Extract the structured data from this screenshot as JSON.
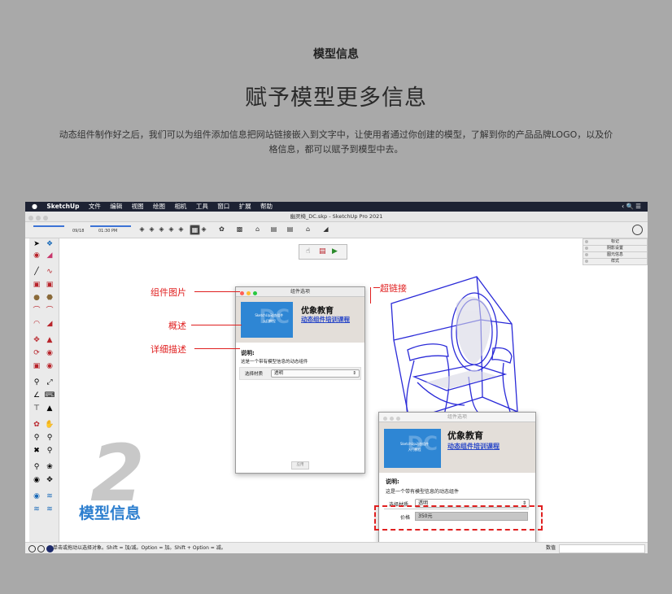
{
  "header": {
    "section": "模型信息",
    "title": "赋予模型更多信息",
    "desc": "动态组件制作好之后，我们可以为组件添加信息把网站链接嵌入到文字中，让使用者通过你创建的模型，了解到你的产品品牌LOGO，以及价格信息，都可以赋予到模型中去。"
  },
  "menubar": {
    "apple": "",
    "items": [
      "SketchUp",
      "文件",
      "编辑",
      "视图",
      "绘图",
      "相机",
      "工具",
      "窗口",
      "扩展",
      "帮助"
    ],
    "right": "‹  🔍  ☰"
  },
  "window": {
    "title": "幽灵椅_DC.skp - SketchUp Pro 2021"
  },
  "timeline": {
    "start": "09/18",
    "time": "01:30 PM"
  },
  "tray": [
    "标记",
    "阴影设置",
    "图元信息",
    "样式"
  ],
  "callouts": {
    "image": "组件图片",
    "summary": "概述",
    "detail": "详细描述",
    "hyperlink": "超链接"
  },
  "dialog": {
    "title": "组件选项",
    "thumb_line1": "SketchUp动态组件",
    "thumb_line2": "入门教程",
    "thumb_mark": "DC",
    "brand": "优象教育",
    "link": "动态组件培训课程",
    "desc_heading": "说明:",
    "desc_text": "这是一个带有模型信息的动态组件",
    "material_label": "选择材质",
    "material_value": "透明",
    "apply_button": "应用",
    "price_label": "价格",
    "price_value": "350元"
  },
  "bigtitle": "模型信息",
  "bignumber": "2",
  "status": {
    "text": "单击或拖动以选择对象。Shift = 加/减。Option = 加。Shift + Option = 减。",
    "value_label": "数值"
  },
  "colors": {
    "accent": "#2d7fcf",
    "callout": "#e02020",
    "wire": "#2a2ad8"
  }
}
